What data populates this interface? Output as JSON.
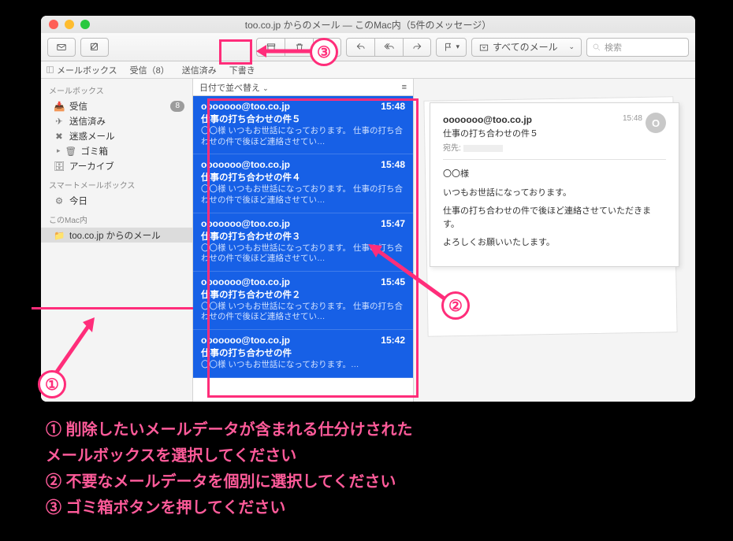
{
  "window": {
    "title": "too.co.jp からのメール — このMac内（5件のメッセージ）"
  },
  "toolbar": {
    "filter_label": "すべてのメール",
    "search_placeholder": "検索"
  },
  "favbar": {
    "mailboxes": "メールボックス",
    "inbox": "受信（8）",
    "sent": "送信済み",
    "drafts": "下書き"
  },
  "sidebar": {
    "hdr_mailboxes": "メールボックス",
    "inbox": "受信",
    "inbox_badge": "8",
    "sent": "送信済み",
    "junk": "迷惑メール",
    "trash": "ゴミ箱",
    "archive": "アーカイブ",
    "hdr_smart": "スマートメールボックス",
    "today": "今日",
    "hdr_local": "このMac内",
    "local_item": "too.co.jp からのメール"
  },
  "sort": {
    "label": "日付で並べ替え"
  },
  "messages": [
    {
      "from": "ooooooo@too.co.jp",
      "time": "15:48",
      "subject": "仕事の打ち合わせの件５",
      "preview": "〇〇様 いつもお世話になっております。 仕事の打ち合わせの件で後ほど連絡させてい…"
    },
    {
      "from": "ooooooo@too.co.jp",
      "time": "15:48",
      "subject": "仕事の打ち合わせの件４",
      "preview": "〇〇様 いつもお世話になっております。 仕事の打ち合わせの件で後ほど連絡させてい…"
    },
    {
      "from": "ooooooo@too.co.jp",
      "time": "15:47",
      "subject": "仕事の打ち合わせの件３",
      "preview": "〇〇様 いつもお世話になっております。 仕事の打ち合わせの件で後ほど連絡させてい…"
    },
    {
      "from": "ooooooo@too.co.jp",
      "time": "15:45",
      "subject": "仕事の打ち合わせの件２",
      "preview": "〇〇様 いつもお世話になっております。 仕事の打ち合わせの件で後ほど連絡させてい…"
    },
    {
      "from": "ooooooo@too.co.jp",
      "time": "15:42",
      "subject": "仕事の打ち合わせの件",
      "preview": "〇〇様 いつもお世話になっております。…"
    }
  ],
  "reader": {
    "from": "ooooooo@too.co.jp",
    "time": "15:48",
    "subject": "仕事の打ち合わせの件５",
    "to_label": "宛先:",
    "avatar": "O",
    "body1": "〇〇様",
    "body2": "いつもお世話になっております。",
    "body3": "仕事の打ち合わせの件で後ほど連絡させていただきます。",
    "body4": "よろしくお願いいたします。"
  },
  "annotations": {
    "n1": "①",
    "n2": "②",
    "n3": "③",
    "inst1": "① 削除したいメールデータが含まれる仕分けされた",
    "inst1b": "メールボックスを選択してください",
    "inst2": "② 不要なメールデータを個別に選択してください",
    "inst3": "③ ゴミ箱ボタンを押してください"
  }
}
